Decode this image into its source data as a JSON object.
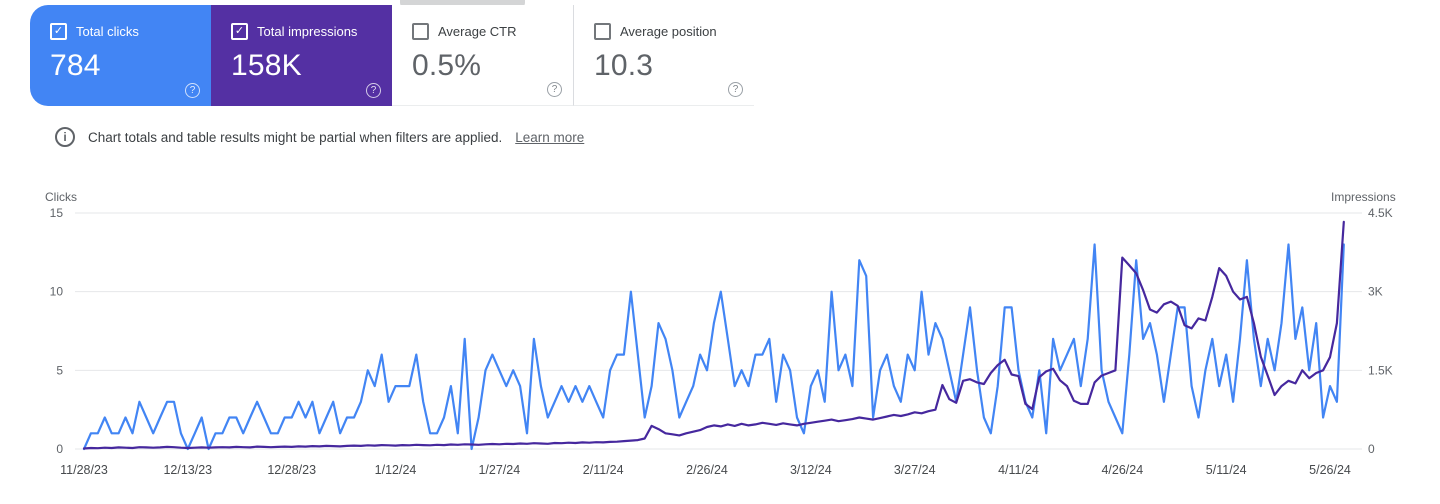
{
  "metrics_cards": [
    {
      "label": "Total clicks",
      "value": "784",
      "checked": true,
      "color": "#4285f4",
      "help_icon": "?"
    },
    {
      "label": "Total impressions",
      "value": "158K",
      "checked": true,
      "color": "#5430a3",
      "help_icon": "?"
    },
    {
      "label": "Average CTR",
      "value": "0.5%",
      "checked": false,
      "color": "#ffffff",
      "help_icon": "?"
    },
    {
      "label": "Average position",
      "value": "10.3",
      "checked": false,
      "color": "#ffffff",
      "help_icon": "?"
    }
  ],
  "info_banner": {
    "icon": "i",
    "text": "Chart totals and table results might be partial when filters are applied.",
    "link_label": "Learn more"
  },
  "colors": {
    "clicks_accent": "#4285f4",
    "impressions_accent": "#5430a3",
    "gridline": "#e6e7e9",
    "axis_text": "#5f6368"
  },
  "chart_data": {
    "type": "line",
    "x_tick_labels": [
      "11/28/23",
      "12/13/23",
      "12/28/23",
      "1/12/24",
      "1/27/24",
      "2/11/24",
      "2/26/24",
      "3/12/24",
      "3/27/24",
      "4/11/24",
      "4/26/24",
      "5/11/24",
      "5/26/24"
    ],
    "x_tick_interval_days": 15,
    "left_axis": {
      "label": "Clicks",
      "max": 15,
      "ticks": [
        0,
        5,
        10,
        15
      ],
      "tick_labels": [
        "0",
        "5",
        "10",
        "15"
      ]
    },
    "right_axis": {
      "label": "Impressions",
      "max": 4500,
      "ticks": [
        0,
        1500,
        3000,
        4500
      ],
      "tick_labels": [
        "0",
        "1.5K",
        "3K",
        "4.5K"
      ]
    },
    "grid": true,
    "series": [
      {
        "name": "Clicks",
        "axis": "left",
        "color": "#4285f4",
        "values": [
          0,
          1,
          1,
          2,
          1,
          1,
          2,
          1,
          3,
          2,
          1,
          2,
          3,
          3,
          1,
          0,
          1,
          2,
          0,
          1,
          1,
          2,
          2,
          1,
          2,
          3,
          2,
          1,
          1,
          2,
          2,
          3,
          2,
          3,
          1,
          2,
          3,
          1,
          2,
          2,
          3,
          5,
          4,
          6,
          3,
          4,
          4,
          4,
          6,
          3,
          1,
          1,
          2,
          4,
          1,
          7,
          0,
          2,
          5,
          6,
          5,
          4,
          5,
          4,
          1,
          7,
          4,
          2,
          3,
          4,
          3,
          4,
          3,
          4,
          3,
          2,
          5,
          6,
          6,
          10,
          6,
          2,
          4,
          8,
          7,
          5,
          2,
          3,
          4,
          6,
          5,
          8,
          10,
          7,
          4,
          5,
          4,
          6,
          6,
          7,
          3,
          6,
          5,
          2,
          1,
          4,
          5,
          3,
          10,
          5,
          6,
          4,
          12,
          11,
          2,
          5,
          6,
          4,
          3,
          6,
          5,
          10,
          6,
          8,
          7,
          5,
          3,
          6,
          9,
          5,
          2,
          1,
          4,
          9,
          9,
          5,
          3,
          2,
          5,
          1,
          7,
          5,
          6,
          7,
          4,
          7,
          13,
          5,
          3,
          2,
          1,
          6,
          12,
          7,
          8,
          6,
          3,
          6,
          9,
          9,
          4,
          2,
          5,
          7,
          4,
          6,
          3,
          7,
          12,
          7,
          4,
          7,
          5,
          8,
          13,
          7,
          9,
          5,
          8,
          2,
          4,
          3,
          13
        ]
      },
      {
        "name": "Impressions",
        "axis": "right",
        "color": "#46289e",
        "values": [
          10,
          20,
          15,
          25,
          20,
          30,
          25,
          20,
          35,
          30,
          25,
          30,
          40,
          35,
          25,
          20,
          25,
          30,
          25,
          30,
          35,
          30,
          40,
          35,
          30,
          45,
          40,
          35,
          40,
          45,
          40,
          50,
          45,
          55,
          50,
          60,
          55,
          50,
          60,
          65,
          60,
          70,
          65,
          75,
          70,
          65,
          75,
          70,
          80,
          75,
          70,
          80,
          75,
          85,
          80,
          90,
          85,
          80,
          90,
          95,
          90,
          100,
          95,
          105,
          100,
          110,
          105,
          100,
          115,
          110,
          120,
          115,
          125,
          120,
          130,
          125,
          135,
          140,
          150,
          160,
          170,
          200,
          440,
          380,
          300,
          280,
          260,
          300,
          330,
          360,
          420,
          450,
          430,
          470,
          440,
          480,
          450,
          470,
          500,
          480,
          460,
          490,
          470,
          450,
          480,
          500,
          520,
          540,
          560,
          530,
          550,
          570,
          600,
          580,
          560,
          590,
          620,
          650,
          630,
          660,
          700,
          680,
          720,
          750,
          1220,
          950,
          880,
          1300,
          1330,
          1270,
          1240,
          1450,
          1600,
          1700,
          1420,
          1390,
          860,
          760,
          1370,
          1480,
          1530,
          1310,
          1200,
          920,
          860,
          860,
          1270,
          1400,
          1450,
          1500,
          3650,
          3500,
          3350,
          3030,
          2660,
          2600,
          2760,
          2810,
          2730,
          2360,
          2300,
          2490,
          2450,
          2900,
          3450,
          3300,
          3000,
          2850,
          2900,
          2400,
          1760,
          1400,
          1030,
          1200,
          1300,
          1250,
          1500,
          1350,
          1450,
          1500,
          1750,
          2400,
          4330
        ]
      }
    ]
  }
}
